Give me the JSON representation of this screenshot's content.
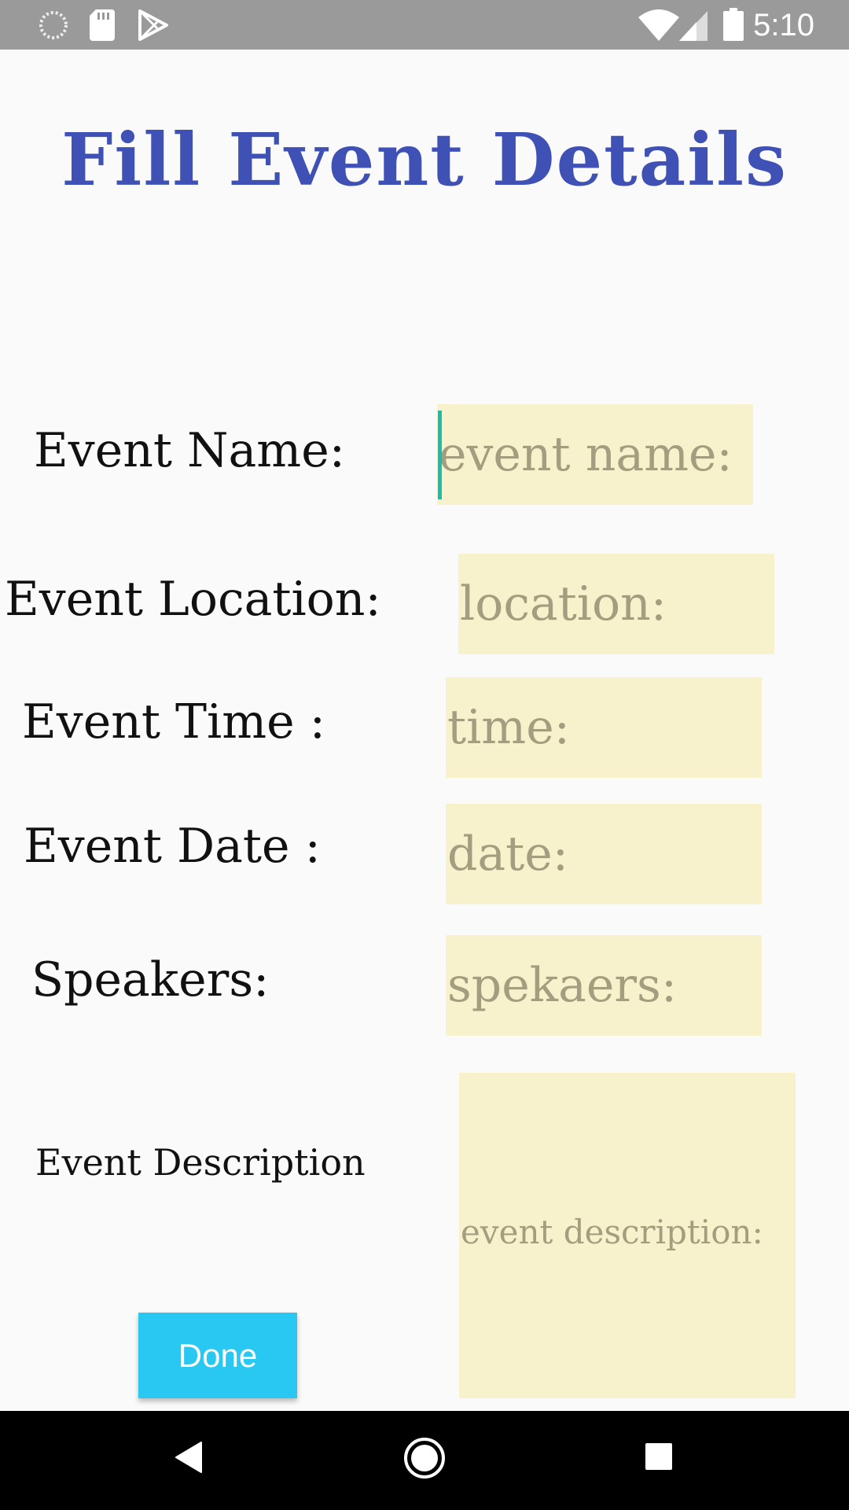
{
  "status_bar": {
    "time": "5:10",
    "left_icons": [
      "loading-circle-icon",
      "sd-card-icon",
      "play-store-icon"
    ],
    "right_icons": [
      "wifi-icon",
      "cellular-signal-icon",
      "battery-icon"
    ]
  },
  "title": "Fill Event Details",
  "form": {
    "event_name_label": "Event Name:",
    "event_name_placeholder": "event name:",
    "location_label": "Event Location:",
    "location_placeholder": "location:",
    "time_label": "Event Time :",
    "time_placeholder": "time:",
    "date_label": "Event Date :",
    "date_placeholder": "date:",
    "speakers_label": "Speakers:",
    "speakers_placeholder": "spekaers:",
    "description_label": "Event Description",
    "description_placeholder": "event description:"
  },
  "done_button": "Done",
  "colors": {
    "title": "#3f51b5",
    "field_bg": "#f7f2cb",
    "done_bg": "#29c8f3",
    "caret": "#19bfae"
  },
  "nav_bar": [
    "back-icon",
    "home-icon",
    "recents-icon"
  ]
}
